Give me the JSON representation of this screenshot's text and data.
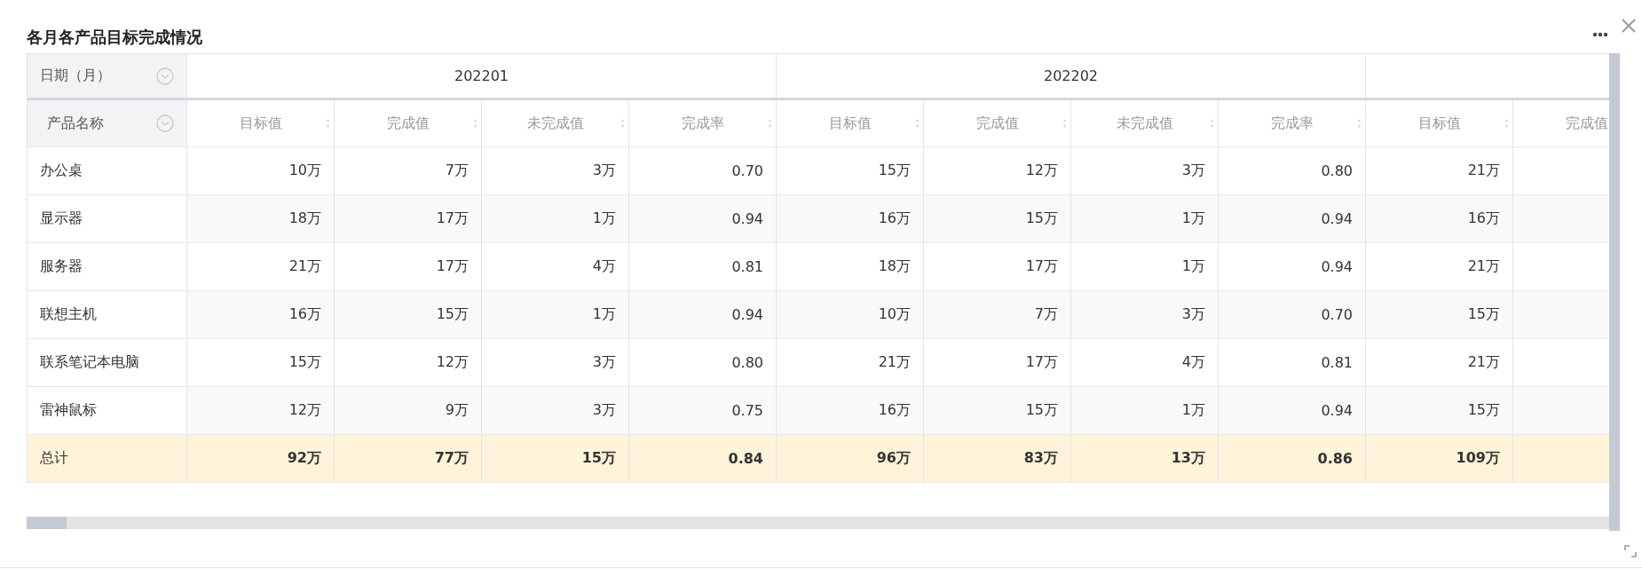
{
  "title": "各月各产品目标完成情况",
  "table": {
    "dimension_labels": [
      "日期（月）",
      "产品名称"
    ],
    "column_groups": [
      {
        "label": "202201",
        "columns": [
          "目标值",
          "完成值",
          "未完成值",
          "完成率"
        ]
      },
      {
        "label": "202202",
        "columns": [
          "目标值",
          "完成值",
          "未完成值",
          "完成率"
        ]
      },
      {
        "columns": [
          "目标值",
          "完成值"
        ]
      }
    ],
    "rows": [
      {
        "name": "办公桌",
        "values": [
          "10万",
          "7万",
          "3万",
          "0.70",
          "15万",
          "12万",
          "3万",
          "0.80",
          "21万"
        ]
      },
      {
        "name": "显示器",
        "values": [
          "18万",
          "17万",
          "1万",
          "0.94",
          "16万",
          "15万",
          "1万",
          "0.94",
          "16万"
        ]
      },
      {
        "name": "服务器",
        "values": [
          "21万",
          "17万",
          "4万",
          "0.81",
          "18万",
          "17万",
          "1万",
          "0.94",
          "21万"
        ]
      },
      {
        "name": "联想主机",
        "values": [
          "16万",
          "15万",
          "1万",
          "0.94",
          "10万",
          "7万",
          "3万",
          "0.70",
          "15万"
        ]
      },
      {
        "name": "联系笔记本电脑",
        "values": [
          "15万",
          "12万",
          "3万",
          "0.80",
          "21万",
          "17万",
          "4万",
          "0.81",
          "21万"
        ]
      },
      {
        "name": "雷神鼠标",
        "values": [
          "12万",
          "9万",
          "3万",
          "0.75",
          "16万",
          "15万",
          "1万",
          "0.94",
          "15万"
        ]
      }
    ],
    "total": {
      "name": "总计",
      "values": [
        "92万",
        "77万",
        "15万",
        "0.84",
        "96万",
        "83万",
        "13万",
        "0.86",
        "109万"
      ]
    }
  }
}
